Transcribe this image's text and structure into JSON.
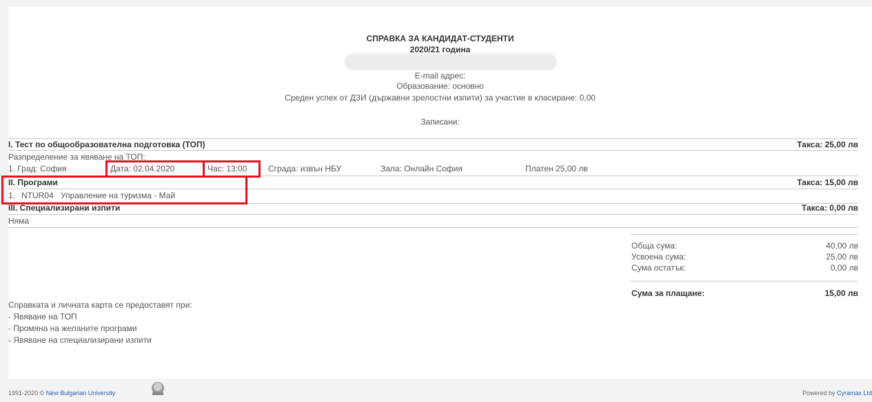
{
  "header": {
    "title": "СПРАВКА ЗА КАНДИДАТ-СТУДЕНТИ",
    "year": "2020/21 година",
    "email": "E-mail адрес:",
    "education": "Образование: основно",
    "average": "Среден успех от ДЗИ (държавни зрелостни изпити) за участие в класиране: 0,00",
    "enrolled": "Записани:"
  },
  "section1": {
    "title": "I. Тест по общообразователна подготовка (ТОП)",
    "fee": "Такса: 25,00 лв",
    "distribution": "Разпределение за явяване на ТОП:",
    "row": {
      "city": "1. Град: София",
      "date": "Дата: 02.04.2020",
      "time": "Час: 13:00",
      "building": "Сграда: извън НБУ",
      "hall": "Зала: Онлайн София",
      "paid": "Платен 25,00 лв"
    }
  },
  "section2": {
    "title": "II. Програми",
    "fee": "Такса: 15,00 лв",
    "num": "1.",
    "code": "NTUR04",
    "name": "Управление на туризма - Май"
  },
  "section3": {
    "title": "III. Специализирани изпити",
    "fee": "Такса: 0,00 лв",
    "none": "Няма"
  },
  "summary": {
    "total_label": "Обща сума:",
    "total_value": "40,00 лв",
    "absorbed_label": "Усвоена сума:",
    "absorbed_value": "25,00 лв",
    "remaining_label": "Сума остатък:",
    "remaining_value": "0,00 лв",
    "pay_label": "Сума за плащане:",
    "pay_value": "15,00 лв"
  },
  "notes": {
    "intro": "Справката и личната карта се предоставят при:",
    "items": [
      "- Явяване на ТОП",
      "- Промяна на желаните програми",
      "- Явяване на специализирани изпити"
    ]
  },
  "footer": {
    "copyright": "1991-2020 © ",
    "university": "New Bulgarian University",
    "powered": "Powered by ",
    "vendor": "Cyramax Ltd"
  },
  "colors": {
    "highlight": "#e8101d",
    "link": "#2a5db0"
  }
}
